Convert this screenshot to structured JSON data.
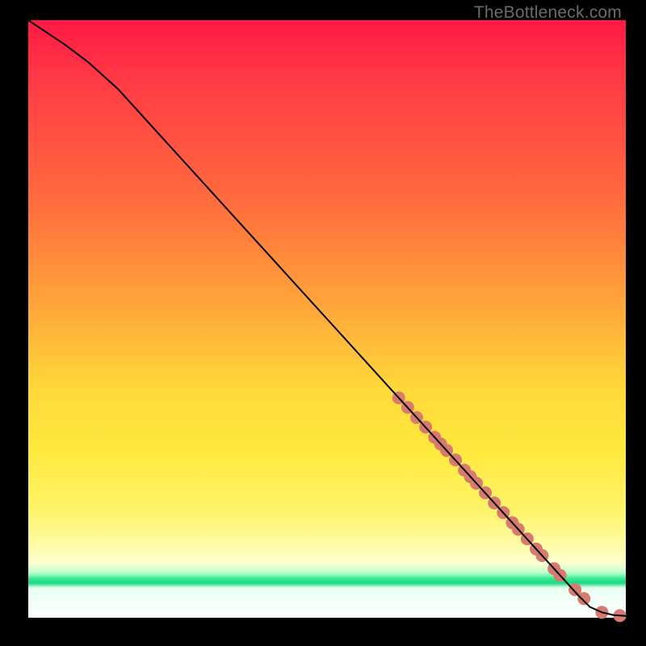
{
  "watermark": "TheBottleneck.com",
  "chart_data": {
    "type": "line",
    "title": "",
    "xlabel": "",
    "ylabel": "",
    "xlim": [
      0,
      100
    ],
    "ylim": [
      0,
      100
    ],
    "grid": false,
    "legend": false,
    "series": [
      {
        "name": "curve",
        "x": [
          0,
          3,
          6,
          10,
          15,
          20,
          25,
          30,
          35,
          40,
          45,
          50,
          55,
          60,
          62,
          65,
          68,
          70,
          73,
          75,
          78,
          80,
          82,
          85,
          88,
          90,
          92,
          94,
          96,
          98,
          100
        ],
        "y": [
          100,
          98,
          96,
          93,
          88.5,
          83,
          77.5,
          72,
          66.5,
          61,
          55.5,
          50,
          44.5,
          39,
          36.8,
          33.5,
          30.2,
          28,
          24.7,
          22.5,
          19.2,
          17,
          14.8,
          11.5,
          8.2,
          6,
          3.8,
          1.8,
          0.9,
          0.45,
          0.3
        ],
        "stroke": "#000000",
        "stroke_width": 2
      },
      {
        "name": "markers",
        "x": [
          62,
          63.5,
          65,
          66.5,
          68,
          69,
          70,
          71.5,
          73,
          74,
          75,
          76.5,
          78,
          79.5,
          81,
          82,
          83.5,
          85,
          86,
          88,
          89,
          91.5,
          93,
          96,
          99
        ],
        "y": [
          36.8,
          35.2,
          33.5,
          31.9,
          30.2,
          29.1,
          28.0,
          26.4,
          24.7,
          23.6,
          22.5,
          20.9,
          19.2,
          17.6,
          15.9,
          14.8,
          13.2,
          11.5,
          10.4,
          8.2,
          7.1,
          4.7,
          3.2,
          0.9,
          0.35
        ],
        "marker_color": "#d77a6f",
        "marker_radius": 8
      }
    ]
  }
}
